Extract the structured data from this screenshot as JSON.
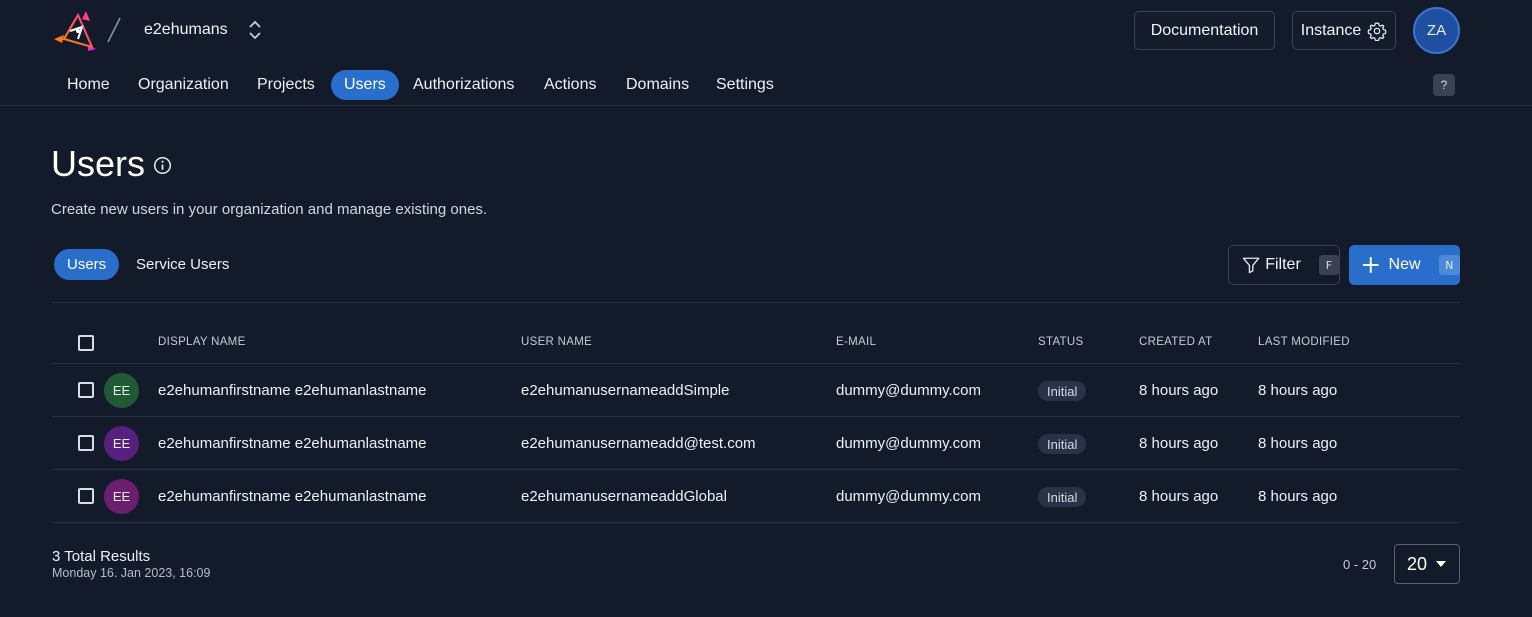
{
  "header": {
    "org_name": "e2ehumans",
    "documentation_label": "Documentation",
    "instance_label": "Instance",
    "user_initials": "ZA"
  },
  "nav": {
    "items": [
      {
        "label": "Home"
      },
      {
        "label": "Organization"
      },
      {
        "label": "Projects"
      },
      {
        "label": "Users"
      },
      {
        "label": "Authorizations"
      },
      {
        "label": "Actions"
      },
      {
        "label": "Domains"
      },
      {
        "label": "Settings"
      }
    ],
    "active": "Users",
    "help_label": "?"
  },
  "page": {
    "title": "Users",
    "description": "Create new users in your organization and manage existing ones."
  },
  "subtabs": {
    "users": "Users",
    "service_users": "Service Users"
  },
  "toolbar": {
    "filter_label": "Filter",
    "filter_shortcut": "F",
    "new_label": "New",
    "new_shortcut": "N"
  },
  "table": {
    "columns": [
      "DISPLAY NAME",
      "USER NAME",
      "E-MAIL",
      "STATUS",
      "CREATED AT",
      "LAST MODIFIED"
    ],
    "rows": [
      {
        "initials": "EE",
        "avatar_color": "#1e5b34",
        "display_name": "e2ehumanfirstname e2ehumanlastname",
        "user_name": "e2ehumanusernameaddSimple",
        "email": "dummy@dummy.com",
        "status": "Initial",
        "created": "8 hours ago",
        "modified": "8 hours ago"
      },
      {
        "initials": "EE",
        "avatar_color": "#57207e",
        "display_name": "e2ehumanfirstname e2ehumanlastname",
        "user_name": "e2ehumanusernameadd@test.com",
        "email": "dummy@dummy.com",
        "status": "Initial",
        "created": "8 hours ago",
        "modified": "8 hours ago"
      },
      {
        "initials": "EE",
        "avatar_color": "#6b1f6e",
        "display_name": "e2ehumanfirstname e2ehumanlastname",
        "user_name": "e2ehumanusernameaddGlobal",
        "email": "dummy@dummy.com",
        "status": "Initial",
        "created": "8 hours ago",
        "modified": "8 hours ago"
      }
    ]
  },
  "footer": {
    "total": "3 Total Results",
    "timestamp": "Monday 16. Jan 2023, 16:09",
    "range": "0 - 20",
    "page_size": "20"
  },
  "colors": {
    "background": "#131a2a",
    "accent": "#2a6ecb"
  }
}
